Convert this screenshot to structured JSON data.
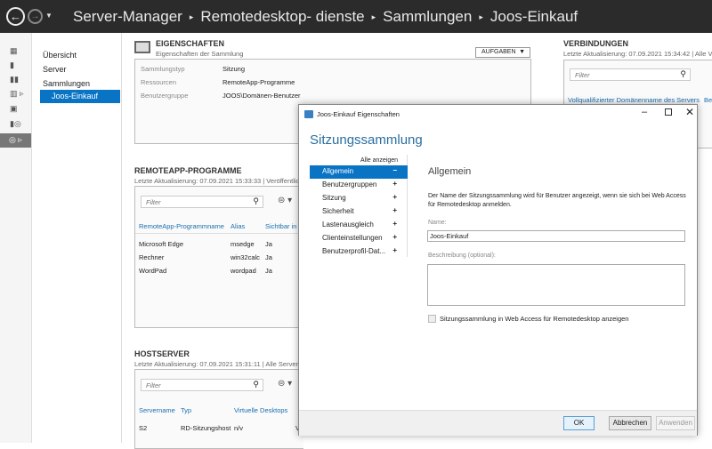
{
  "breadcrumb": [
    "Server-Manager",
    "Remotedesktop- dienste",
    "Sammlungen",
    "Joos-Einkauf"
  ],
  "nav": {
    "items": [
      "Übersicht",
      "Server",
      "Sammlungen",
      "Joos-Einkauf"
    ]
  },
  "properties": {
    "title": "EIGENSCHAFTEN",
    "subtitle": "Eigenschaften der Sammlung",
    "tasks": "AUFGABEN",
    "rows": [
      {
        "k": "Sammlungstyp",
        "v": "Sitzung"
      },
      {
        "k": "Ressourcen",
        "v": "RemoteApp-Programme"
      },
      {
        "k": "Benutzergruppe",
        "v": "JOOS\\Domänen-Benutzer"
      }
    ]
  },
  "connections": {
    "title": "VERBINDUNGEN",
    "subtitle": "Letzte Aktualisierung: 07.09.2021 15:34:42 | Alle Ve",
    "filter": "Filter",
    "columns": [
      "Vollqualifizierter Domänenname des Servers",
      "Be"
    ]
  },
  "remoteapp": {
    "title": "REMOTEAPP-PROGRAMME",
    "subtitle": "Letzte Aktualisierung: 07.09.2021 15:33:33 | Veröffentlic",
    "filter": "Filter",
    "columns": [
      "RemoteApp-Programmname",
      "Alias",
      "Sichtbar in"
    ],
    "rows": [
      [
        "Microsoft Edge",
        "msedge",
        "Ja"
      ],
      [
        "Rechner",
        "win32calc",
        "Ja"
      ],
      [
        "WordPad",
        "wordpad",
        "Ja"
      ]
    ]
  },
  "hostserver": {
    "title": "HOSTSERVER",
    "subtitle": "Letzte Aktualisierung: 07.09.2021 15:31:11 | Alle Server",
    "filter": "Filter",
    "columns": [
      "Servername",
      "Typ",
      "Virtuelle Desktops"
    ],
    "rows": [
      [
        "S2",
        "RD-Sitzungshost",
        "n/v",
        "V"
      ]
    ]
  },
  "dialog": {
    "title": "Joos-Einkauf Eigenschaften",
    "heading": "Sitzungssammlung",
    "show_all": "Alle anzeigen",
    "items": [
      {
        "label": "Allgemein",
        "pm": "−"
      },
      {
        "label": "Benutzergruppen",
        "pm": "+"
      },
      {
        "label": "Sitzung",
        "pm": "+"
      },
      {
        "label": "Sicherheit",
        "pm": "+"
      },
      {
        "label": "Lastenausgleich",
        "pm": "+"
      },
      {
        "label": "Clienteinstellungen",
        "pm": "+"
      },
      {
        "label": "Benutzerprofil-Dat...",
        "pm": "+"
      }
    ],
    "section": "Allgemein",
    "desc": "Der Name der Sitzungssammlung wird für Benutzer angezeigt, wenn sie sich bei Web Access für Remotedesktop anmelden.",
    "name_label": "Name:",
    "name_value": "Joos-Einkauf",
    "desc_label": "Beschreibung (optional):",
    "desc_value": "",
    "checkbox": "Sitzungssammlung in Web Access für Remotedesktop anzeigen",
    "checked": false,
    "ok": "OK",
    "cancel": "Abbrechen",
    "apply": "Anwenden"
  }
}
